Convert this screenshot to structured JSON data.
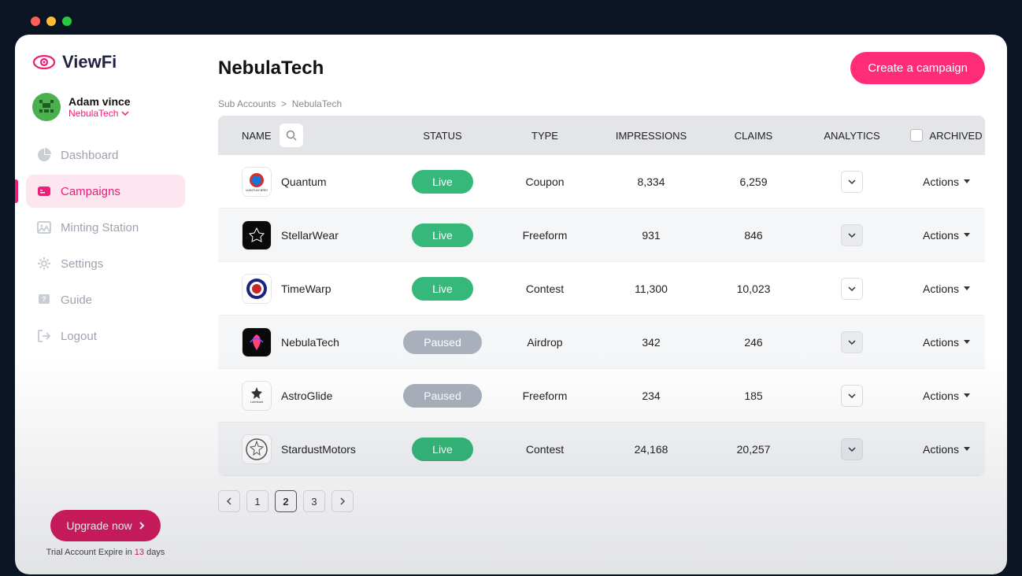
{
  "brand": {
    "name": "ViewFi"
  },
  "user": {
    "name": "Adam vince",
    "account": "NebulaTech"
  },
  "sidebar": {
    "items": [
      {
        "label": "Dashboard"
      },
      {
        "label": "Campaigns"
      },
      {
        "label": "Minting Station"
      },
      {
        "label": "Settings"
      },
      {
        "label": "Guide"
      },
      {
        "label": "Logout"
      }
    ],
    "upgrade": "Upgrade now",
    "trial_prefix": "Trial Account Expire in ",
    "trial_days": "13",
    "trial_suffix": " days"
  },
  "header": {
    "title": "NebulaTech",
    "create_btn": "Create a campaign"
  },
  "breadcrumb": {
    "root": "Sub Accounts",
    "sep": ">",
    "current": "NebulaTech"
  },
  "columns": {
    "name": "NAME",
    "status": "STATUS",
    "type": "TYPE",
    "impressions": "IMPRESSIONS",
    "claims": "CLAIMS",
    "analytics": "ANALYTICS",
    "archived": "ARCHIVED"
  },
  "rows": [
    {
      "name": "Quantum",
      "status": "Live",
      "type": "Coupon",
      "impressions": "8,334",
      "claims": "6,259",
      "action": "Actions"
    },
    {
      "name": "StellarWear",
      "status": "Live",
      "type": "Freeform",
      "impressions": "931",
      "claims": "846",
      "action": "Actions"
    },
    {
      "name": "TimeWarp",
      "status": "Live",
      "type": "Contest",
      "impressions": "11,300",
      "claims": "10,023",
      "action": "Actions"
    },
    {
      "name": "NebulaTech",
      "status": "Paused",
      "type": "Airdrop",
      "impressions": "342",
      "claims": "246",
      "action": "Actions"
    },
    {
      "name": "AstroGlide",
      "status": "Paused",
      "type": "Freeform",
      "impressions": "234",
      "claims": "185",
      "action": "Actions"
    },
    {
      "name": "StardustMotors",
      "status": "Live",
      "type": "Contest",
      "impressions": "24,168",
      "claims": "20,257",
      "action": "Actions"
    }
  ],
  "pagination": {
    "pages": [
      "1",
      "2",
      "3"
    ],
    "current": "2"
  }
}
